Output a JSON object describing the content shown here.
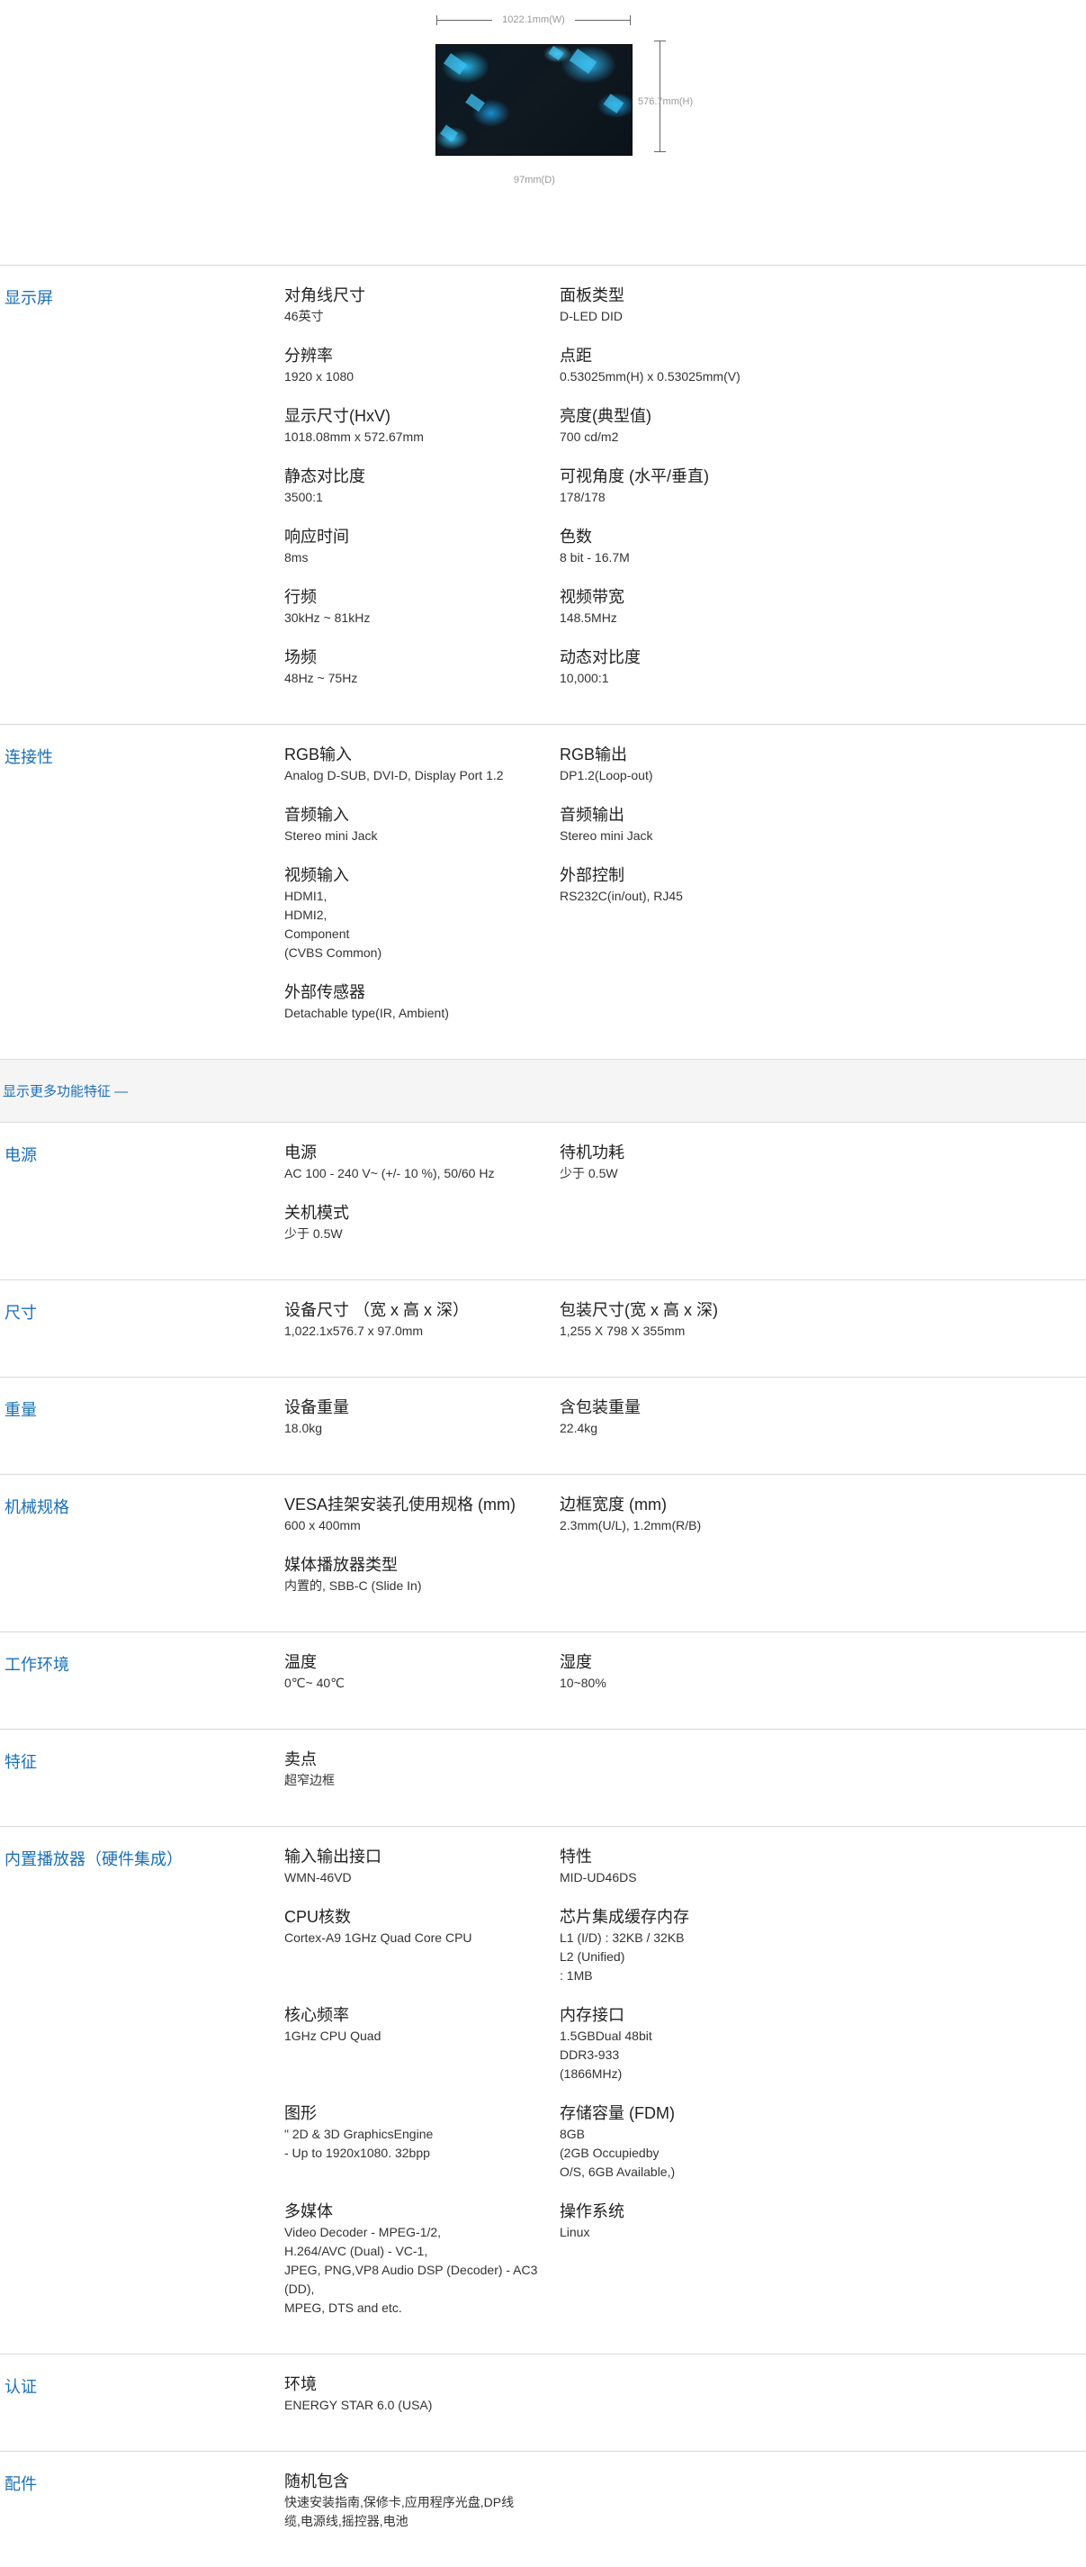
{
  "hero": {
    "width_label": "1022.1mm(W)",
    "height_label": "576.7mm(H)",
    "depth_label": "97mm(D)"
  },
  "more_features": "显示更多功能特征 —",
  "sections": [
    {
      "title": "显示屏",
      "items": [
        {
          "k": "对角线尺寸",
          "v": "46英寸"
        },
        {
          "k": "面板类型",
          "v": "D-LED DID"
        },
        {
          "k": "分辨率",
          "v": "1920 x 1080"
        },
        {
          "k": "点距",
          "v": "0.53025mm(H) x 0.53025mm(V)"
        },
        {
          "k": "显示尺寸(HxV)",
          "v": "1018.08mm x 572.67mm"
        },
        {
          "k": "亮度(典型值)",
          "v": "700 cd/m2"
        },
        {
          "k": "静态对比度",
          "v": "3500:1"
        },
        {
          "k": "可视角度 (水平/垂直)",
          "v": "178/178"
        },
        {
          "k": "响应时间",
          "v": "8ms"
        },
        {
          "k": "色数",
          "v": "8 bit - 16.7M"
        },
        {
          "k": "行频",
          "v": "30kHz ~ 81kHz"
        },
        {
          "k": "视频带宽",
          "v": "148.5MHz"
        },
        {
          "k": "场频",
          "v": "48Hz ~ 75Hz"
        },
        {
          "k": "动态对比度",
          "v": "10,000:1"
        }
      ]
    },
    {
      "title": "连接性",
      "items": [
        {
          "k": "RGB输入",
          "v": "Analog D-SUB, DVI-D, Display Port 1.2"
        },
        {
          "k": "RGB输出",
          "v": "DP1.2(Loop-out)"
        },
        {
          "k": "音频输入",
          "v": "Stereo mini Jack"
        },
        {
          "k": "音频输出",
          "v": "Stereo mini Jack"
        },
        {
          "k": "视频输入",
          "v": "HDMI1,\nHDMI2,\nComponent\n(CVBS Common)"
        },
        {
          "k": "外部控制",
          "v": "RS232C(in/out), RJ45"
        },
        {
          "k": "外部传感器",
          "v": "Detachable type(IR, Ambient)"
        }
      ]
    },
    {
      "title": "电源",
      "items": [
        {
          "k": "电源",
          "v": "AC 100 - 240 V~ (+/- 10 %), 50/60 Hz"
        },
        {
          "k": "待机功耗",
          "v": "少于 0.5W"
        },
        {
          "k": "关机模式",
          "v": "少于 0.5W"
        }
      ]
    },
    {
      "title": "尺寸",
      "items": [
        {
          "k": "设备尺寸 （宽 x 高 x 深）",
          "v": "1,022.1x576.7 x 97.0mm"
        },
        {
          "k": "包装尺寸(宽 x 高 x 深)",
          "v": "1,255 X 798 X 355mm"
        }
      ]
    },
    {
      "title": "重量",
      "items": [
        {
          "k": "设备重量",
          "v": "18.0kg"
        },
        {
          "k": "含包装重量",
          "v": "22.4kg"
        }
      ]
    },
    {
      "title": "机械规格",
      "items": [
        {
          "k": "VESA挂架安装孔使用规格 (mm)",
          "v": "600 x 400mm"
        },
        {
          "k": "边框宽度 (mm)",
          "v": "2.3mm(U/L), 1.2mm(R/B)"
        },
        {
          "k": "媒体播放器类型",
          "v": "内置的, SBB-C (Slide In)"
        }
      ]
    },
    {
      "title": "工作环境",
      "items": [
        {
          "k": "温度",
          "v": "0℃~ 40℃"
        },
        {
          "k": "湿度",
          "v": "10~80%"
        }
      ]
    },
    {
      "title": "特征",
      "items": [
        {
          "k": "卖点",
          "v": "超窄边框"
        }
      ]
    },
    {
      "title": "内置播放器（硬件集成）",
      "items": [
        {
          "k": "输入输出接口",
          "v": "WMN-46VD"
        },
        {
          "k": "特性",
          "v": "MID-UD46DS"
        },
        {
          "k": "CPU核数",
          "v": "Cortex-A9 1GHz Quad Core CPU"
        },
        {
          "k": "芯片集成缓存内存",
          "v": "L1 (I/D) : 32KB / 32KB\nL2 (Unified)\n: 1MB"
        },
        {
          "k": "核心频率",
          "v": "1GHz CPU Quad"
        },
        {
          "k": "内存接口",
          "v": "1.5GBDual 48bit\nDDR3-933\n(1866MHz)"
        },
        {
          "k": "图形",
          "v": "\" 2D & 3D GraphicsEngine\n- Up to 1920x1080. 32bpp"
        },
        {
          "k": "存储容量 (FDM)",
          "v": "8GB\n(2GB Occupiedby\nO/S, 6GB Available,)"
        },
        {
          "k": "多媒体",
          "v": "Video Decoder - MPEG-1/2,\nH.264/AVC (Dual) - VC-1,\nJPEG, PNG,VP8 Audio DSP (Decoder) - AC3\n(DD),\nMPEG, DTS and etc."
        },
        {
          "k": "操作系统",
          "v": "Linux"
        }
      ]
    },
    {
      "title": "认证",
      "items": [
        {
          "k": "环境",
          "v": "ENERGY STAR 6.0 (USA)"
        }
      ]
    },
    {
      "title": "配件",
      "items": [
        {
          "k": "随机包含",
          "v": "快速安装指南,保修卡,应用程序光盘,DP线\n缆,电源线,摇控器,电池"
        }
      ]
    }
  ]
}
